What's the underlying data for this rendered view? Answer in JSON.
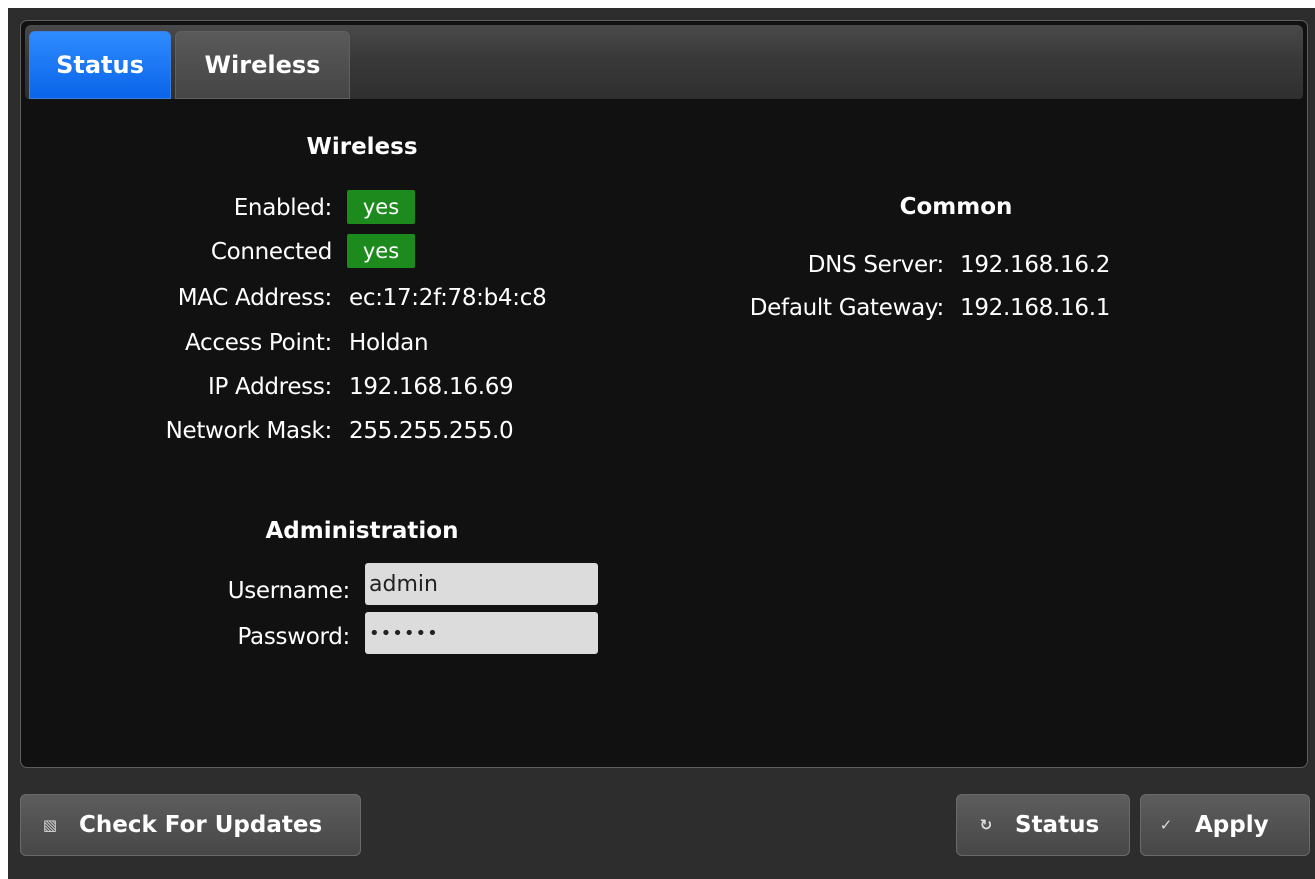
{
  "tabs": [
    {
      "label": "Status",
      "active": true
    },
    {
      "label": "Wireless",
      "active": false
    }
  ],
  "wireless": {
    "title": "Wireless",
    "enabled_label": "Enabled:",
    "enabled_value": "yes",
    "connected_label": "Connected",
    "connected_value": "yes",
    "mac_label": "MAC Address:",
    "mac_value": "ec:17:2f:78:b4:c8",
    "ap_label": "Access Point:",
    "ap_value": "Holdan",
    "ip_label": "IP Address:",
    "ip_value": "192.168.16.69",
    "mask_label": "Network Mask:",
    "mask_value": "255.255.255.0"
  },
  "common": {
    "title": "Common",
    "dns_label": "DNS Server:",
    "dns_value": "192.168.16.2",
    "gateway_label": "Default Gateway:",
    "gateway_value": "192.168.16.1"
  },
  "administration": {
    "title": "Administration",
    "username_label": "Username:",
    "username_value": "admin",
    "password_label": "Password:",
    "password_value": "••••••"
  },
  "buttons": {
    "check_updates_label": "Check For Updates",
    "check_updates_icon": "disk-icon",
    "status_label": "Status",
    "status_icon": "refresh-icon",
    "apply_label": "Apply",
    "apply_icon": "checkmark-icon"
  },
  "colors": {
    "active_tab": "#0a64e8",
    "badge_green": "#1c8a1c",
    "background": "#111111"
  }
}
